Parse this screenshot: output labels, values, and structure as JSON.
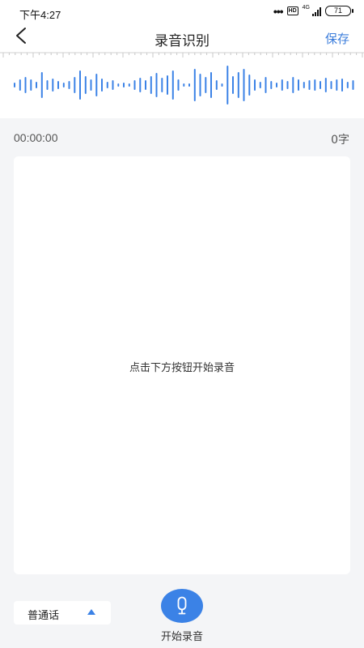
{
  "status_bar": {
    "time": "下午4:27",
    "dots": "•••",
    "hd": "HD",
    "network": "4G",
    "battery": "71"
  },
  "header": {
    "title": "录音识别",
    "save_label": "保存",
    "back_icon": "chevron-left-icon"
  },
  "recording": {
    "elapsed": "00:00:00",
    "char_count": "0字",
    "hint": "点击下方按钮开始录音"
  },
  "controls": {
    "language": "普通话",
    "record_label": "开始录音",
    "mic_icon": "microphone-icon"
  },
  "colors": {
    "accent": "#3b82e6",
    "link": "#3b7ddb",
    "background": "#f4f5f7"
  }
}
